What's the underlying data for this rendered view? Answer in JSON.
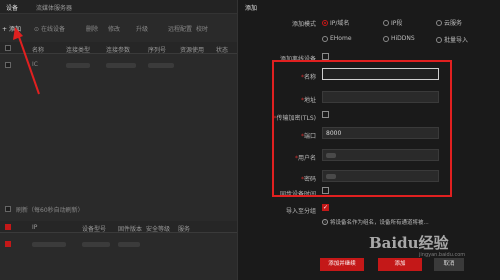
{
  "background": {
    "tabs": [
      "设备",
      "流媒体服务器"
    ],
    "toolbar": {
      "add": "添加",
      "online": "在线设备",
      "delete": "删除",
      "modify": "修改",
      "upgrade": "升级",
      "config": "远程配置",
      "time": "校时"
    },
    "table_headers": [
      "名称",
      "连接类型",
      "连接参数",
      "序列号",
      "资源使用",
      "状态"
    ],
    "row1_name": "IC",
    "lower_toolbar": "刷新（每60秒自动刷新）",
    "lower_headers": [
      "IP",
      "设备型号",
      "固件版本",
      "安全等级",
      "服务"
    ]
  },
  "dialog": {
    "title": "添加",
    "add_mode_label": "添加模式",
    "modes": [
      {
        "label": "IP/域名",
        "selected": true
      },
      {
        "label": "IP段",
        "selected": false
      },
      {
        "label": "云服务",
        "selected": false
      },
      {
        "label": "EHome",
        "selected": false
      },
      {
        "label": "HiDDNS",
        "selected": false
      },
      {
        "label": "批量导入",
        "selected": false
      }
    ],
    "offline_label": "添加离线设备",
    "name_label": "名称",
    "address_label": "地址",
    "tls_label": "传输加密(TLS)",
    "port_label": "端口",
    "port_value": "8000",
    "user_label": "用户名",
    "password_label": "密码",
    "sync_time_label": "同步设备时间",
    "import_group_label": "导入至分组",
    "hint": "将设备名作为组名，设备所有通道将被...",
    "buttons": {
      "add_new": "添加并继续",
      "add": "添加",
      "cancel": "取消"
    },
    "watermark": "Baidu经验",
    "watermark_sub": "jingyan.baidu.com"
  },
  "colors": {
    "accent": "#c41818",
    "annotation": "#e02020"
  }
}
